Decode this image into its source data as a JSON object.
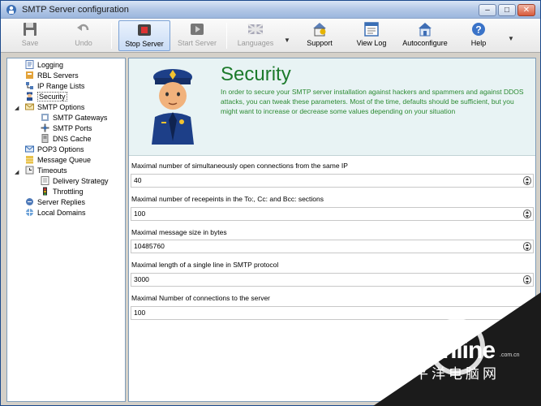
{
  "window": {
    "title": "SMTP Server configuration"
  },
  "toolbar": {
    "buttons": [
      {
        "label": "Save",
        "icon": "floppy-disk-icon",
        "enabled": false
      },
      {
        "label": "Undo",
        "icon": "undo-arrow-icon",
        "enabled": false
      },
      {
        "label": "Stop Server",
        "icon": "stop-icon",
        "enabled": true,
        "pressed": true
      },
      {
        "label": "Start Server",
        "icon": "start-icon",
        "enabled": false
      },
      {
        "label": "Languages",
        "icon": "flag-icon",
        "enabled": false
      },
      {
        "label": "Support",
        "icon": "support-house-icon",
        "enabled": true
      },
      {
        "label": "View Log",
        "icon": "log-window-icon",
        "enabled": true
      },
      {
        "label": "Autoconfigure",
        "icon": "autoconfigure-house-icon",
        "enabled": true
      },
      {
        "label": "Help",
        "icon": "help-icon",
        "enabled": true
      }
    ]
  },
  "tree": {
    "items": [
      {
        "label": "Logging",
        "level": 1,
        "icon": "log-icon"
      },
      {
        "label": "RBL Servers",
        "level": 1,
        "icon": "rbl-icon"
      },
      {
        "label": "IP Range Lists",
        "level": 1,
        "icon": "ip-icon"
      },
      {
        "label": "Security",
        "level": 1,
        "icon": "cop-icon",
        "selected": true
      },
      {
        "label": "SMTP Options",
        "level": 1,
        "icon": "envelope-icon",
        "expanded": true
      },
      {
        "label": "SMTP Gateways",
        "level": 2,
        "icon": "gateway-icon"
      },
      {
        "label": "SMTP Ports",
        "level": 2,
        "icon": "ports-icon"
      },
      {
        "label": "DNS Cache",
        "level": 2,
        "icon": "dns-icon"
      },
      {
        "label": "POP3 Options",
        "level": 1,
        "icon": "pop3-icon"
      },
      {
        "label": "Message Queue",
        "level": 1,
        "icon": "queue-icon"
      },
      {
        "label": "Timeouts",
        "level": 1,
        "icon": "timeouts-icon",
        "expanded": true
      },
      {
        "label": "Delivery Strategy",
        "level": 2,
        "icon": "delivery-icon"
      },
      {
        "label": "Throttling",
        "level": 2,
        "icon": "throttle-icon"
      },
      {
        "label": "Server Replies",
        "level": 1,
        "icon": "replies-icon"
      },
      {
        "label": "Local Domains",
        "level": 1,
        "icon": "domains-icon"
      }
    ]
  },
  "security": {
    "title": "Security",
    "description": "In order to secure your SMTP server installation against hackers and spammers and against DDOS attacks, you can tweak these parameters. Most of the time, defaults should be sufficient, but you might want to increase or decrease some values depending on your situation",
    "fields": [
      {
        "label": "Maximal number of simultaneously open connections from the same IP",
        "value": "40"
      },
      {
        "label": "Maximal number of recepeints in the To:, Cc: and Bcc: sections",
        "value": "100"
      },
      {
        "label": "Maximal message size in bytes",
        "value": "10485760"
      },
      {
        "label": "Maximal length of a single line in SMTP protocol",
        "value": "3000"
      },
      {
        "label": "Maximal Number of connections to the server",
        "value": "100"
      }
    ]
  },
  "watermark": {
    "brand": "PConline",
    "domain": ".com.cn",
    "chinese": "太平洋电脑网"
  },
  "colors": {
    "title_green": "#1c7a2b",
    "header_bg": "#e8f3f4"
  }
}
